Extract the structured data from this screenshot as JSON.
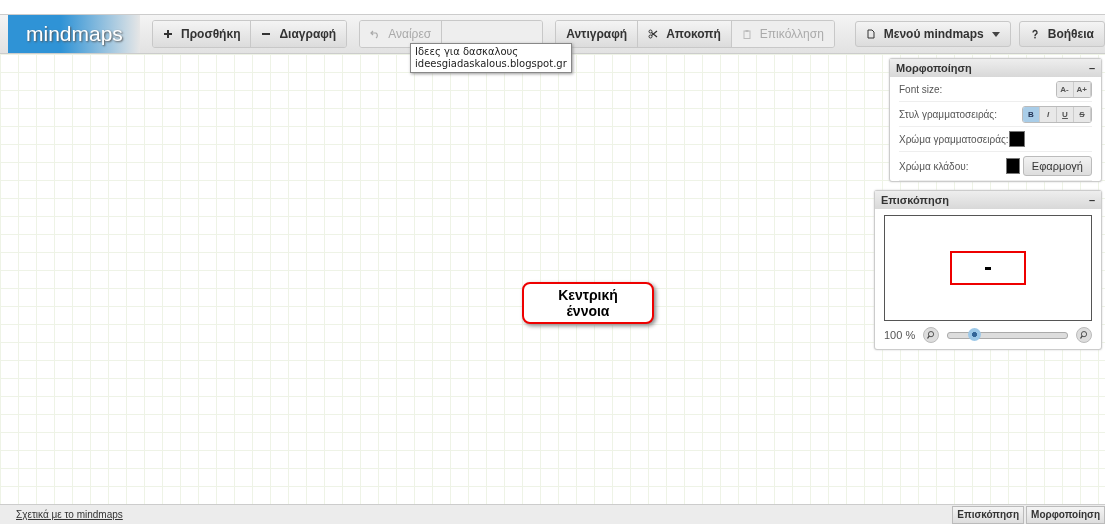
{
  "logo": "mindmaps",
  "toolbar_groups": [
    {
      "buttons": [
        {
          "label": "Προσθήκη",
          "kind": "plus",
          "disabled": false
        },
        {
          "label": "Διαγραφή",
          "kind": "minus",
          "disabled": false
        }
      ]
    },
    {
      "buttons": [
        {
          "label": "Αναίρεσ",
          "kind": "undo",
          "disabled": true
        },
        {
          "kind": "blank",
          "disabled": true
        }
      ]
    },
    {
      "buttons": [
        {
          "label": "Αντιγραφή",
          "kind": "blank",
          "disabled": false
        },
        {
          "label": "Αποκοπή",
          "kind": "scissors",
          "disabled": false
        },
        {
          "label": "Επικόλληση",
          "kind": "clipboard",
          "disabled": true
        }
      ]
    }
  ],
  "menu_buttons": [
    {
      "label": "Μενού mindmaps",
      "kind": "page",
      "caret": true
    },
    {
      "label": "Βοήθεια",
      "kind": "question",
      "caret": false
    }
  ],
  "tooltip": {
    "lines": [
      "Ιδεες για δασκαλους",
      "ideesgiadaskalous.blogspot.gr"
    ]
  },
  "central_node": {
    "lines": [
      "Κεντρική",
      "έννοια"
    ]
  },
  "format_panel": {
    "title": "Μορφοποίηση",
    "collapse": "–",
    "font_size": {
      "label": "Font size:",
      "buttons": [
        "A-",
        "A+"
      ]
    },
    "font_style": {
      "label": "Στυλ γραμματοσειράς:",
      "buttons": [
        {
          "label": "B",
          "selected": true
        },
        {
          "label": "I",
          "selected": false
        },
        {
          "label": "U",
          "selected": false
        },
        {
          "label": "S",
          "selected": false
        }
      ]
    },
    "font_color": {
      "label": "Χρώμα γραμματοσειράς:",
      "color": "#000000"
    },
    "branch_color": {
      "label": "Χρώμα κλάδου:",
      "color": "#000000",
      "apply": "Εφαρμογή"
    }
  },
  "overview_panel": {
    "title": "Επισκόπηση",
    "collapse": "–",
    "zoom": "100 %",
    "level": 0.22
  },
  "footer": {
    "link": "Σχετικά με το mindmaps",
    "buttons": [
      "Επισκόπηση",
      "Μορφοποίηση"
    ]
  }
}
